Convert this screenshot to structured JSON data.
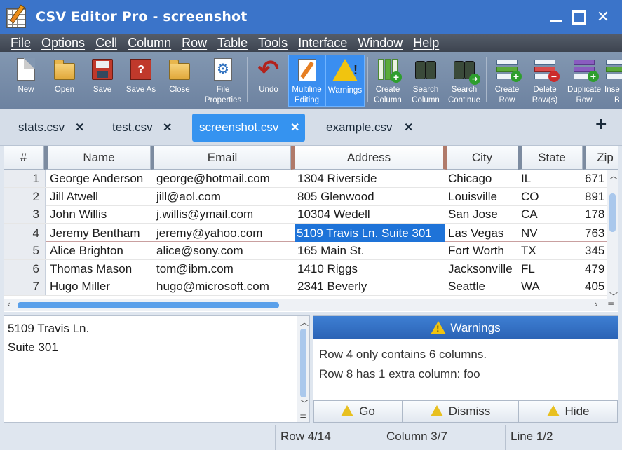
{
  "window": {
    "title": "CSV Editor Pro - screenshot"
  },
  "menu": [
    "File",
    "Options",
    "Cell",
    "Column",
    "Row",
    "Table",
    "Tools",
    "Interface",
    "Window",
    "Help"
  ],
  "toolbar": {
    "new": "New",
    "open": "Open",
    "save": "Save",
    "save_as": "Save As",
    "close": "Close",
    "file_properties": [
      "File",
      "Properties"
    ],
    "undo": "Undo",
    "multiline_editing": [
      "Multiline",
      "Editing"
    ],
    "warnings": "Warnings",
    "create_column": [
      "Create",
      "Column"
    ],
    "search_column": [
      "Search",
      "Column"
    ],
    "search_continue": [
      "Search",
      "Continue"
    ],
    "create_row": [
      "Create",
      "Row"
    ],
    "delete_rows": [
      "Delete",
      "Row(s)"
    ],
    "duplicate_row": [
      "Duplicate",
      "Row"
    ],
    "insert_partial": [
      "Inse",
      "B"
    ]
  },
  "tabs": [
    {
      "label": "stats.csv",
      "active": false
    },
    {
      "label": "test.csv",
      "active": false
    },
    {
      "label": "screenshot.csv",
      "active": true
    },
    {
      "label": "example.csv",
      "active": false
    }
  ],
  "tab_close_glyph": "✕",
  "tab_add_glyph": "+",
  "grid": {
    "headers": [
      "#",
      "Name",
      "Email",
      "Address",
      "City",
      "State",
      "Zip"
    ],
    "rows": [
      [
        "1",
        "George Anderson",
        "george@hotmail.com",
        "1304 Riverside",
        "Chicago",
        "IL",
        "671"
      ],
      [
        "2",
        "Jill Atwell",
        "jill@aol.com",
        "805 Glenwood",
        "Louisville",
        "CO",
        "891"
      ],
      [
        "3",
        "John Willis",
        "j.willis@ymail.com",
        "10304 Wedell",
        "San Jose",
        "CA",
        "178"
      ],
      [
        "4",
        "Jeremy Bentham",
        "jeremy@yahoo.com",
        "5109 Travis Ln. Suite 301",
        "Las Vegas",
        "NV",
        "763"
      ],
      [
        "5",
        "Alice Brighton",
        "alice@sony.com",
        "165 Main St.",
        "Fort Worth",
        "TX",
        "345"
      ],
      [
        "6",
        "Thomas Mason",
        "tom@ibm.com",
        "1410 Riggs",
        "Jacksonville",
        "FL",
        "479"
      ],
      [
        "7",
        "Hugo Miller",
        "hugo@microsoft.com",
        "2341 Beverly",
        "Seattle",
        "WA",
        "405"
      ]
    ],
    "selected_row": 4,
    "selected_column": 3
  },
  "editor": {
    "lines": [
      "5109 Travis Ln.",
      "Suite 301"
    ]
  },
  "warnings": {
    "title": "Warnings",
    "messages": [
      "Row 4 only contains 6 columns.",
      "Row 8 has 1 extra column: foo"
    ],
    "go": "Go",
    "dismiss": "Dismiss",
    "hide": "Hide"
  },
  "status": {
    "row": "Row 4/14",
    "column": "Column 3/7",
    "line": "Line 1/2"
  },
  "colors": {
    "titlebar": "#3b74c9",
    "toolbar": "#7b8fab",
    "active_tab": "#3593f0",
    "selection": "#1e73d8"
  }
}
